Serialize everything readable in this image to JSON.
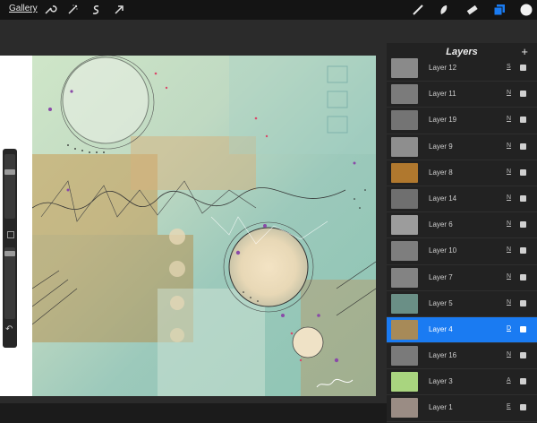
{
  "topbar": {
    "gallery_label": "Gallery",
    "left_tools": [
      "wrench-icon",
      "magic-wand-icon",
      "selection-icon",
      "transform-arrow-icon"
    ],
    "right_tools": [
      "brush-icon",
      "smudge-icon",
      "eraser-icon",
      "layers-icon",
      "color-swatch-icon"
    ]
  },
  "layers_panel": {
    "title": "Layers",
    "add_label": "+",
    "rows": [
      {
        "name": "Layer 12",
        "blend": "S",
        "thumb": "#8a8a8a",
        "selected": false
      },
      {
        "name": "Layer 11",
        "blend": "N",
        "thumb": "#7b7b7b",
        "selected": false
      },
      {
        "name": "Layer 19",
        "blend": "N",
        "thumb": "#747474",
        "selected": false
      },
      {
        "name": "Layer 9",
        "blend": "N",
        "thumb": "#8e8e8e",
        "selected": false
      },
      {
        "name": "Layer 8",
        "blend": "N",
        "thumb": "#b0782e",
        "selected": false
      },
      {
        "name": "Layer 14",
        "blend": "N",
        "thumb": "#6f6f6f",
        "selected": false
      },
      {
        "name": "Layer 6",
        "blend": "N",
        "thumb": "#9c9c9c",
        "selected": false
      },
      {
        "name": "Layer 10",
        "blend": "N",
        "thumb": "#7e7e7e",
        "selected": false
      },
      {
        "name": "Layer 7",
        "blend": "N",
        "thumb": "#838383",
        "selected": false
      },
      {
        "name": "Layer 5",
        "blend": "N",
        "thumb": "#6a8f86",
        "selected": false
      },
      {
        "name": "Layer 4",
        "blend": "D",
        "thumb": "#a78a58",
        "selected": true
      },
      {
        "name": "Layer 16",
        "blend": "N",
        "thumb": "#7a7a7a",
        "selected": false
      },
      {
        "name": "Layer 3",
        "blend": "A",
        "thumb": "#a9d57f",
        "selected": false
      },
      {
        "name": "Layer 1",
        "blend": "E",
        "thumb": "#9a8c84",
        "selected": false
      }
    ]
  },
  "sidebar": {
    "size_slider_fraction": 0.25,
    "opacity_slider_fraction": 0.05,
    "undo_icon": "undo-arrow-icon"
  },
  "colors": {
    "accent": "#1a7bf2",
    "background": "#1b1b1b",
    "panel": "#222222",
    "selected_row": "#1a7bf2"
  }
}
